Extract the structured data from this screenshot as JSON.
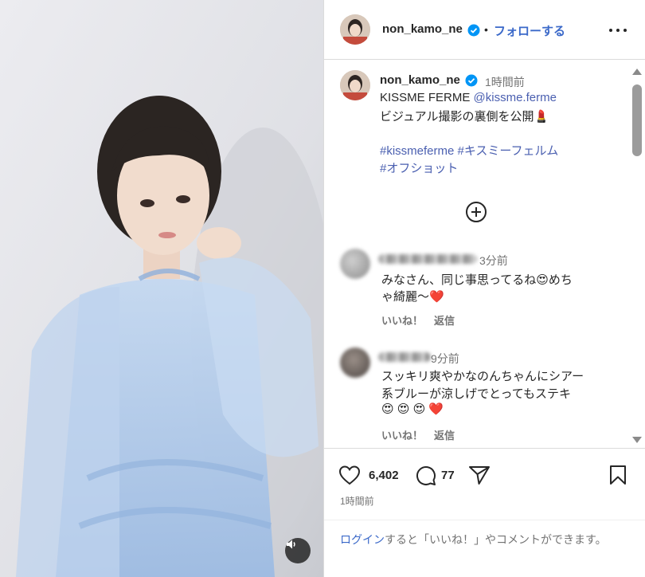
{
  "header": {
    "username": "non_kamo_ne",
    "separator": "•",
    "follow_label": "フォローする"
  },
  "caption": {
    "username": "non_kamo_ne",
    "time": "1時間前",
    "line1_text": "KISSME FERME ",
    "line1_mention": "@kissme.ferme",
    "line2": "ビジュアル撮影の裏側を公開💄",
    "hashtag1": "#kissmeferme",
    "hashtag2": "#キスミーフェルム",
    "hashtag3": "#オフショット"
  },
  "comments": [
    {
      "time": "3分前",
      "line1": "みなさん、同じ事思ってるね😍めち",
      "line2": "ゃ綺麗〜❤️",
      "like_label": "いいね！",
      "reply_label": "返信"
    },
    {
      "time": "9分前",
      "line1": "スッキリ爽やかなのんちゃんにシアー",
      "line2": "系ブルーが涼しげでとってもステキ",
      "line3": "😍 😍 😍 ❤️",
      "like_label": "いいね！",
      "reply_label": "返信"
    }
  ],
  "stats": {
    "likes": "6,402",
    "comments": "77",
    "posted": "1時間前"
  },
  "login": {
    "link": "ログイン",
    "rest": "すると「いいね！」やコメントができます。"
  },
  "colors": {
    "accent": "#3b69c9",
    "verified": "#0095f6",
    "muted": "#737373"
  }
}
